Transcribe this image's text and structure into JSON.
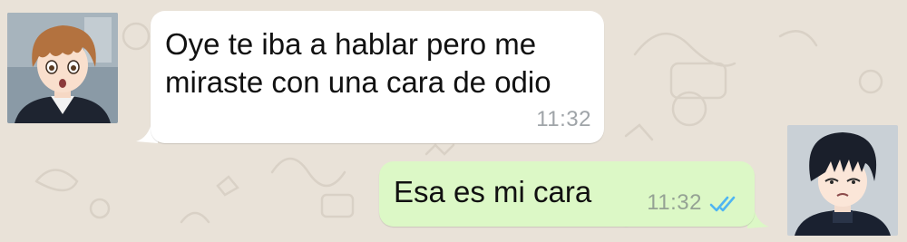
{
  "chat": {
    "messages": [
      {
        "direction": "incoming",
        "text": "Oye te iba a hablar pero me\nmiraste con una cara de odio",
        "time": "11:32",
        "avatar": "anime-boy-brown-hair-avatar"
      },
      {
        "direction": "outgoing",
        "text": "Esa es mi cara",
        "time": "11:32",
        "status": "read",
        "status_icon": "double-check-icon",
        "avatar": "anime-boy-black-hair-avatar"
      }
    ]
  },
  "colors": {
    "background": "#e9e2d8",
    "incoming_bubble": "#ffffff",
    "outgoing_bubble": "#dcf8c6",
    "read_ticks": "#4fb5f2",
    "timestamp": "#9fa4a8"
  }
}
